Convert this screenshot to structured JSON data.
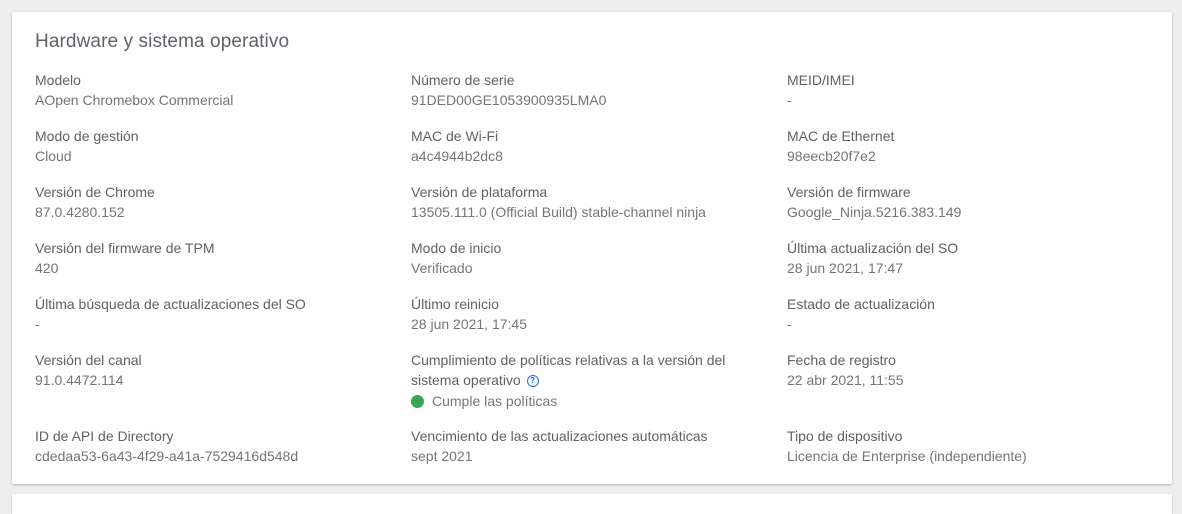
{
  "card": {
    "title": "Hardware y sistema operativo"
  },
  "fields": {
    "modelo": {
      "label": "Modelo",
      "value": "AOpen Chromebox Commercial"
    },
    "numero_serie": {
      "label": "Número de serie",
      "value": "91DED00GE1053900935LMA0"
    },
    "meid_imei": {
      "label": "MEID/IMEI",
      "value": "-"
    },
    "modo_gestion": {
      "label": "Modo de gestión",
      "value": "Cloud"
    },
    "mac_wifi": {
      "label": "MAC de Wi-Fi",
      "value": "a4c4944b2dc8"
    },
    "mac_ethernet": {
      "label": "MAC de Ethernet",
      "value": "98eecb20f7e2"
    },
    "version_chrome": {
      "label": "Versión de Chrome",
      "value": "87.0.4280.152"
    },
    "version_plataforma": {
      "label": "Versión de plataforma",
      "value": "13505.111.0 (Official Build) stable-channel ninja"
    },
    "version_firmware": {
      "label": "Versión de firmware",
      "value": "Google_Ninja.5216.383.149"
    },
    "version_firmware_tpm": {
      "label": "Versión del firmware de TPM",
      "value": "420"
    },
    "modo_inicio": {
      "label": "Modo de inicio",
      "value": "Verificado"
    },
    "ultima_actualizacion_so": {
      "label": "Última actualización del SO",
      "value": "28 jun 2021, 17:47"
    },
    "ultima_busqueda": {
      "label": "Última búsqueda de actualizaciones del SO",
      "value": "-"
    },
    "ultimo_reinicio": {
      "label": "Último reinicio",
      "value": "28 jun 2021, 17:45"
    },
    "estado_actualizacion": {
      "label": "Estado de actualización",
      "value": "-"
    },
    "version_canal": {
      "label": "Versión del canal",
      "value": "91.0.4472.114"
    },
    "cumplimiento": {
      "label_line1": "Cumplimiento de políticas relativas a la versión del",
      "label_line2": "sistema operativo",
      "help_icon": "help-circle-icon",
      "status_text": "Cumple las políticas",
      "status_color": "#34a853"
    },
    "fecha_registro": {
      "label": "Fecha de registro",
      "value": "22 abr 2021, 11:55"
    },
    "id_api_directory": {
      "label": "ID de API de Directory",
      "value": "cdedaa53-6a43-4f29-a41a-7529416d548d"
    },
    "vencimiento": {
      "label": "Vencimiento de las actualizaciones automáticas",
      "value": "sept 2021"
    },
    "tipo_dispositivo": {
      "label": "Tipo de dispositivo",
      "value": "Licencia de Enterprise (independiente)"
    }
  }
}
